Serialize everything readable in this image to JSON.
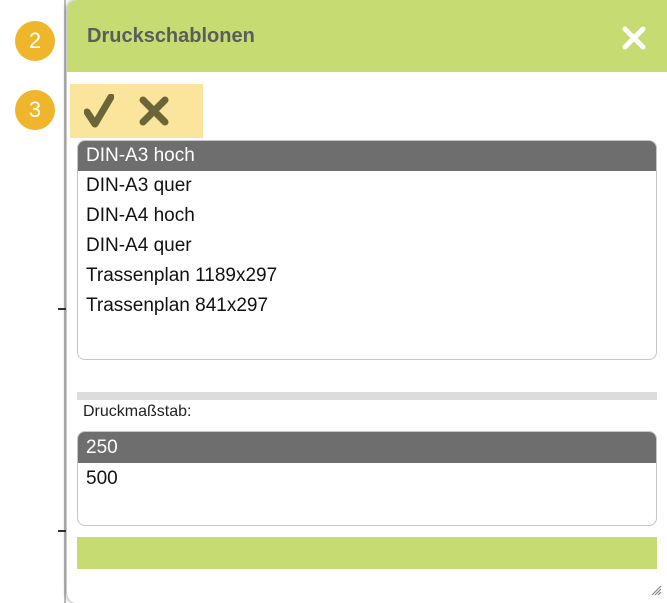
{
  "dialog": {
    "title": "Druckschablonen",
    "close_icon": "close-icon",
    "ok_icon": "checkmark-icon",
    "cancel_icon": "x-icon"
  },
  "badges": [
    "2",
    "3"
  ],
  "templates": {
    "selected_index": 0,
    "items": [
      "DIN-A3 hoch",
      "DIN-A3 quer",
      "DIN-A4 hoch",
      "DIN-A4 quer",
      "Trassenplan 1189x297",
      "Trassenplan 841x297"
    ]
  },
  "scale": {
    "label": "Druckmaßstab:",
    "selected_index": 0,
    "items": [
      "250",
      "500"
    ]
  },
  "colors": {
    "accent_green": "#c6dc72",
    "highlight_yellow": "#fbe49b",
    "badge_orange": "#f0b62b",
    "selection_gray": "#6e6e6e",
    "icon_olive": "#6b6639"
  }
}
